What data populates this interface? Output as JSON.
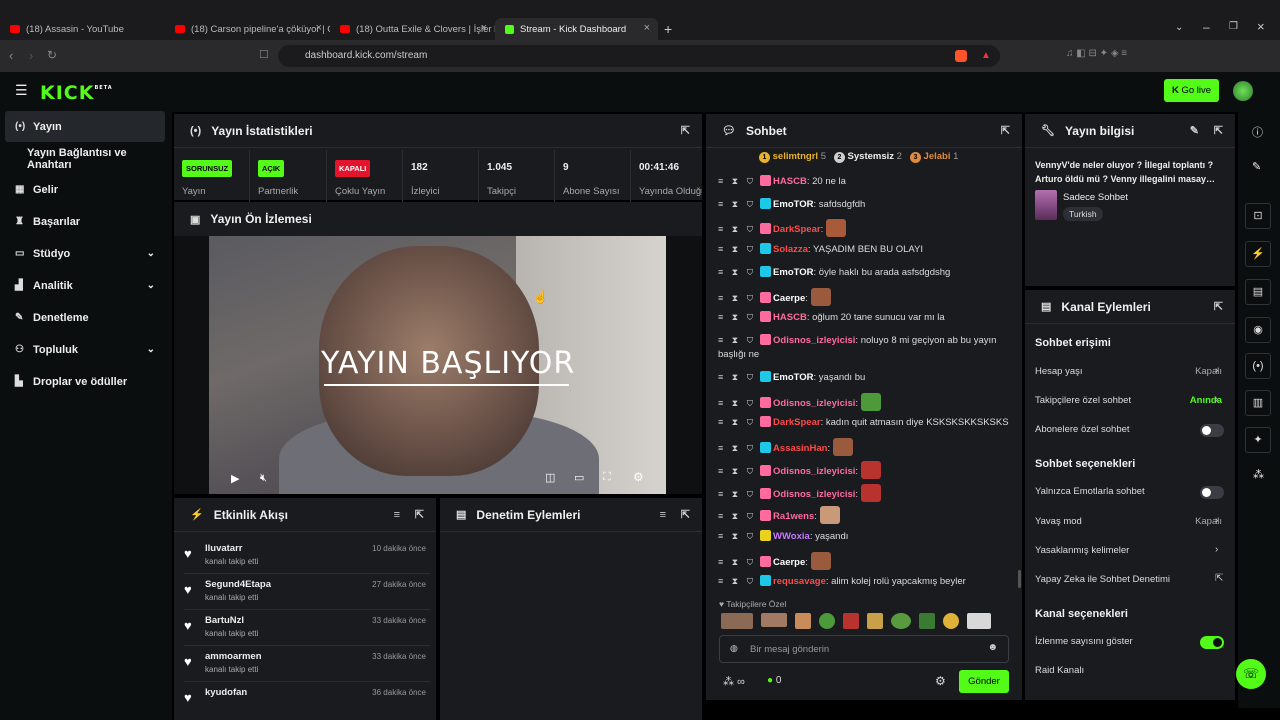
{
  "browser": {
    "tabs": [
      {
        "title": "(18) Assasin - YouTube"
      },
      {
        "title": "(18) Carson pipeline'a çöküyor | Cars"
      },
      {
        "title": "(18) Outta Exile & Clovers | İşler kızışı"
      },
      {
        "title": "Stream - Kick Dashboard"
      }
    ],
    "url": "dashboard.kick.com/stream"
  },
  "header": {
    "logo": "KICK",
    "beta": "BETA",
    "go_live": "Go live"
  },
  "sidebar": {
    "items": [
      {
        "label": "Yayın",
        "icon": "broadcast-icon"
      },
      {
        "label": "Yayın Bağlantısı ve Anahtarı",
        "icon": ""
      },
      {
        "label": "Gelir",
        "icon": "revenue-icon"
      },
      {
        "label": "Başarılar",
        "icon": "trophy-icon"
      },
      {
        "label": "Stüdyo",
        "icon": "studio-icon"
      },
      {
        "label": "Analitik",
        "icon": "analytics-icon"
      },
      {
        "label": "Denetleme",
        "icon": "wrench-icon"
      },
      {
        "label": "Topluluk",
        "icon": "community-icon"
      },
      {
        "label": "Droplar ve ödüller",
        "icon": "drops-icon"
      }
    ]
  },
  "stats": {
    "title": "Yayın İstatistikleri",
    "items": [
      {
        "badge": "SORUNSUZ",
        "label": "Yayın",
        "color": "#53fc18"
      },
      {
        "badge": "AÇIK",
        "label": "Partnerlik",
        "color": "#53fc18"
      },
      {
        "badge": "KAPALI",
        "label": "Çoklu Yayın",
        "color": "#e3152d"
      },
      {
        "value": "182",
        "label": "İzleyici"
      },
      {
        "value": "1.045",
        "label": "Takipçi"
      },
      {
        "value": "9",
        "label": "Abone Sayısı"
      },
      {
        "value": "00:41:46",
        "label": "Yayında Olduğu"
      }
    ]
  },
  "preview": {
    "title": "Yayın Ön İzlemesi",
    "overlay_text": "YAYIN BAŞLIYOR"
  },
  "activity": {
    "title": "Etkinlik Akışı",
    "items": [
      {
        "name": "lluvatarr",
        "action": "kanalı takip etti",
        "time": "10 dakika önce"
      },
      {
        "name": "Segund4Etapa",
        "action": "kanalı takip etti",
        "time": "27 dakika önce"
      },
      {
        "name": "BartuNzl",
        "action": "kanalı takip etti",
        "time": "33 dakika önce"
      },
      {
        "name": "ammoarmen",
        "action": "kanalı takip etti",
        "time": "33 dakika önce"
      },
      {
        "name": "kyudofan",
        "action": "",
        "time": "36 dakika önce"
      }
    ]
  },
  "moderation": {
    "title": "Denetim Eylemleri"
  },
  "chat": {
    "title": "Sohbet",
    "leaders": [
      {
        "rank": "1",
        "name": "selimtngrl",
        "count": "5",
        "color": "#e8b22a"
      },
      {
        "rank": "2",
        "name": "Systemsiz",
        "count": "2",
        "color": "#cfcfcf"
      },
      {
        "rank": "3",
        "name": "Jelabi",
        "count": "1",
        "color": "#e08a3a"
      }
    ],
    "messages": [
      {
        "user": "HASCB",
        "text": "20 ne la",
        "color": "#ff6b9d"
      },
      {
        "user": "EmoTOR",
        "text": "safdsdgfdh",
        "color": "#ffffff"
      },
      {
        "user": "DarkSpear",
        "text": "",
        "color": "#ff4a4a"
      },
      {
        "user": "Solazza",
        "text": "YAŞADIM BEN BU OLAYI",
        "color": "#ff4a4a"
      },
      {
        "user": "EmoTOR",
        "text": "öyle haklı bu arada asfsdgdshg",
        "color": "#ffffff"
      },
      {
        "user": "Caerpe",
        "text": "",
        "color": "#ffffff"
      },
      {
        "user": "HASCB",
        "text": "oğlum 20 tane sunucu var mı la",
        "color": "#ff6b9d"
      },
      {
        "user": "Odisnos_izleyicisi",
        "text": "noluyo 8 mi geçiyon ab bu yayın başlığı ne",
        "color": "#ff6b9d"
      },
      {
        "user": "EmoTOR",
        "text": "yaşandı bu",
        "color": "#ffffff"
      },
      {
        "user": "Odisnos_izleyicisi",
        "text": "",
        "color": "#ff6b9d"
      },
      {
        "user": "DarkSpear",
        "text": "kadın quit atmasın diye KSKSKSKKSKSKS",
        "color": "#ff4a4a"
      },
      {
        "user": "AssasinHan",
        "text": "",
        "color": "#ff4a4a"
      },
      {
        "user": "Odisnos_izleyicisi",
        "text": "",
        "color": "#ff6b9d"
      },
      {
        "user": "Odisnos_izleyicisi",
        "text": "",
        "color": "#ff6b9d"
      },
      {
        "user": "Ra1wens",
        "text": "",
        "color": "#ff6b9d"
      },
      {
        "user": "WWoxia",
        "text": "yaşandı",
        "color": "#c67bff"
      },
      {
        "user": "Caerpe",
        "text": "",
        "color": "#ffffff"
      },
      {
        "user": "requsavage",
        "text": "alim kolej rolü yapcakmış beyler",
        "color": "#ff4a4a"
      }
    ],
    "followers_only": "Takipçilere Özel",
    "placeholder": "Bir mesaj gönderin",
    "count": "0",
    "send": "Gönder"
  },
  "stream_info": {
    "title": "Yayın bilgisi",
    "stream_title": "VennyV'de neler oluyor ? İllegal toplantı ? Arturo öldü mü ? Venny illegalini masay…",
    "category": "Sadece Sohbet",
    "language": "Turkish"
  },
  "channel_actions": {
    "title": "Kanal Eylemleri",
    "chat_access": "Sohbet erişimi",
    "account_age": {
      "label": "Hesap yaşı",
      "value": "Kapalı"
    },
    "followers_chat": {
      "label": "Takipçilere özel sohbet",
      "value": "Anında"
    },
    "subs_chat": {
      "label": "Abonelere özel sohbet"
    },
    "chat_options": "Sohbet seçenekleri",
    "emote_only": {
      "label": "Yalnızca Emotlarla sohbet"
    },
    "slow_mode": {
      "label": "Yavaş mod",
      "value": "Kapalı"
    },
    "banned_words": {
      "label": "Yasaklanmış kelimeler"
    },
    "ai_mod": {
      "label": "Yapay Zeka ile Sohbet Denetimi"
    },
    "channel_options": "Kanal seçenekleri",
    "show_viewers": {
      "label": "İzlenme sayısını göster"
    },
    "raid": {
      "label": "Raid Kanalı"
    }
  },
  "colors": {
    "accent": "#53fc18",
    "panel": "#191b1f",
    "bg": "#0b0e0f"
  }
}
